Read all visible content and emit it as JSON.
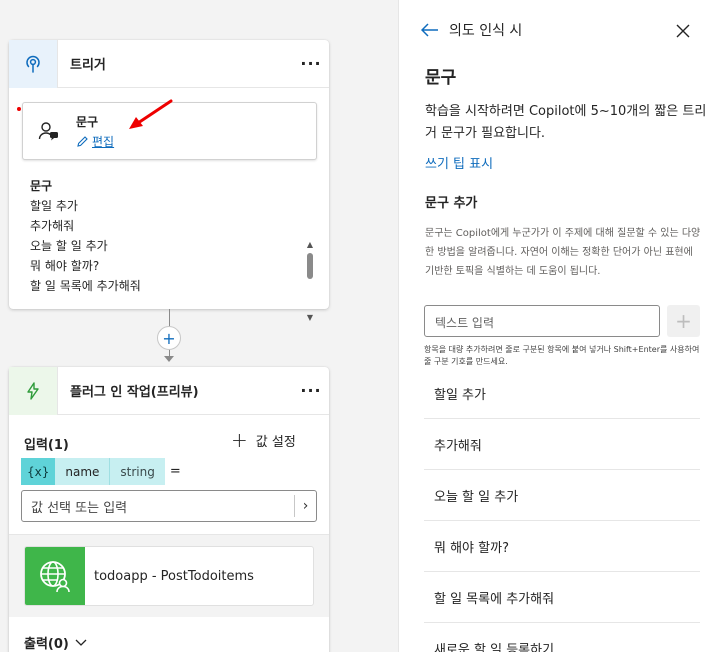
{
  "trigger_card": {
    "title": "트리거",
    "more_label": "···",
    "phrase_box": {
      "title": "문구",
      "edit_label": "편집"
    },
    "phrases_title": "문구",
    "phrases": [
      "할일 추가",
      "추가해줘",
      "오늘 할 일 추가",
      "뭐 해야 할까?",
      "할 일 목록에 추가해줘"
    ]
  },
  "connector": {
    "add_label": "+"
  },
  "plugin_card": {
    "title": "플러그 인 작업(프리뷰)",
    "more_label": "···",
    "input_label": "입력(1)",
    "set_value_label": "값 설정",
    "variable": {
      "badge": "{x}",
      "name": "name",
      "type": "string",
      "equals": "="
    },
    "value_placeholder": "값 선택 또는 입력",
    "action_name": "todoapp - PostTodoitems",
    "output_label": "출력(0)"
  },
  "panel": {
    "back_label": "의도 인식 시",
    "title": "문구",
    "description": "학습을 시작하려면 Copilot에 5~10개의 짧은 트리거 문구가 필요합니다.",
    "tips_link": "쓰기 팁 표시",
    "add_heading": "문구 추가",
    "add_description": "문구는 Copilot에게 누군가가 이 주제에 대해 질문할 수 있는 다양한 방법을 알려줍니다. 자연어 이해는 정확한 단어가 아닌 표현에 기반한 토픽을 식별하는 데 도움이 됩니다.",
    "input_placeholder": "텍스트 입력",
    "hint": "항목을 대량 추가하려면 줄로 구분된 항목에 붙여 넣거나 Shift+Enter를 사용하여 줄 구분 기호를 만드세요.",
    "phrases": [
      "할일 추가",
      "추가해줘",
      "오늘 할 일 추가",
      "뭐 해야 할까?",
      "할 일 목록에 추가해줘",
      "새로운 할 일 등록하기"
    ]
  },
  "colors": {
    "accent": "#0f6cbd",
    "annotation": "#e00000",
    "action_icon_bg": "#3fb64a",
    "variable_badge": "#5fd3d8"
  }
}
